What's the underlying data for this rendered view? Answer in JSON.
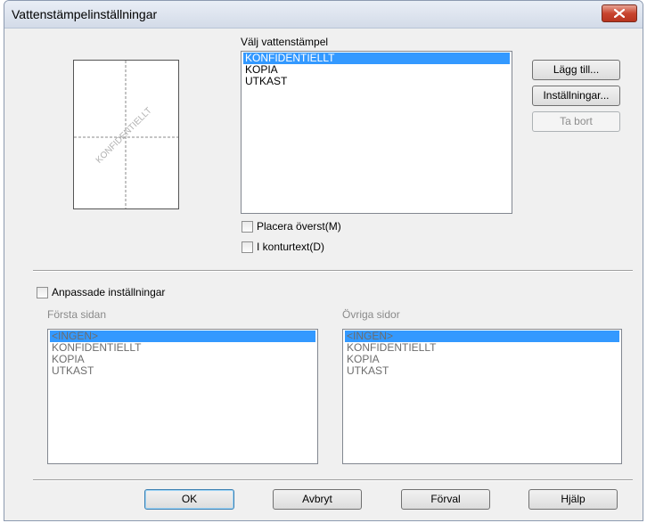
{
  "window": {
    "title": "Vattenstämpelinställningar"
  },
  "preview": {
    "watermark_text": "KONFIDENTIELLT"
  },
  "watermark": {
    "label": "Välj vattenstämpel",
    "items": [
      "KONFIDENTIELLT",
      "KOPIA",
      "UTKAST"
    ],
    "selected_index": 0
  },
  "side_buttons": {
    "add": "Lägg till...",
    "settings": "Inställningar...",
    "delete": "Ta bort"
  },
  "options": {
    "place_top": "Placera överst(M)",
    "outline": "I konturtext(D)"
  },
  "custom": {
    "label": "Anpassade inställningar",
    "first_page": {
      "label": "Första sidan",
      "items": [
        "<INGEN>",
        "KONFIDENTIELLT",
        "KOPIA",
        "UTKAST"
      ]
    },
    "other_pages": {
      "label": "Övriga sidor",
      "items": [
        "<INGEN>",
        "KONFIDENTIELLT",
        "KOPIA",
        "UTKAST"
      ]
    }
  },
  "footer": {
    "ok": "OK",
    "cancel": "Avbryt",
    "default": "Förval",
    "help": "Hjälp"
  }
}
